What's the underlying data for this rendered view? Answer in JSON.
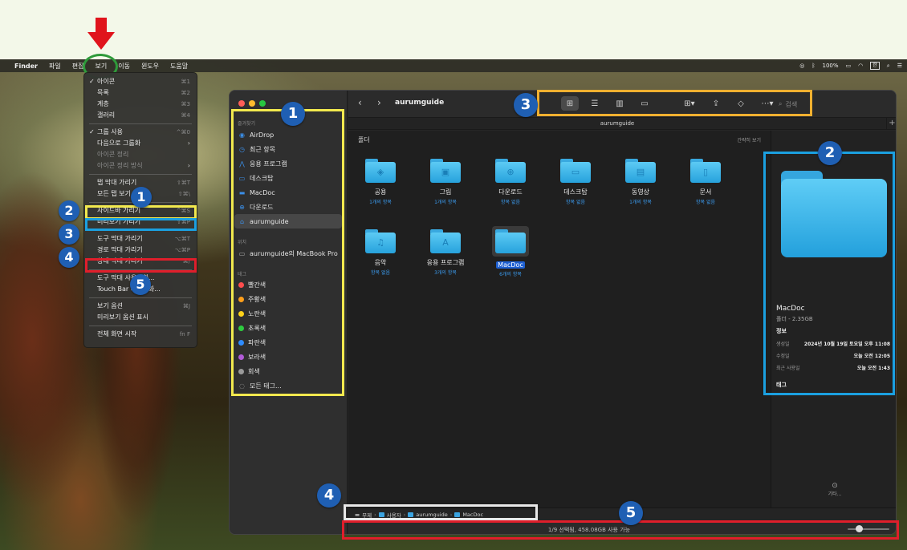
{
  "menubar": {
    "app": "Finder",
    "menus": [
      "파일",
      "편집",
      "보기",
      "이동",
      "윈도우",
      "도움말"
    ],
    "battery": "100%",
    "input_source": "한"
  },
  "view_menu": {
    "items": [
      {
        "label": "아이콘",
        "shortcut": "⌘1",
        "checked": true
      },
      {
        "label": "목록",
        "shortcut": "⌘2"
      },
      {
        "label": "계층",
        "shortcut": "⌘3"
      },
      {
        "label": "갤러리",
        "shortcut": "⌘4"
      },
      {
        "label": "그룹 사용",
        "shortcut": "^⌘0",
        "checked": true
      },
      {
        "label": "다음으로 그룹화",
        "submenu": true
      },
      {
        "label": "아이콘 정리",
        "disabled": true
      },
      {
        "label": "아이콘 정리 방식",
        "disabled": true,
        "submenu": true
      },
      {
        "label": "탭 막대 가리기",
        "shortcut": "⇧⌘T"
      },
      {
        "label": "모든 탭 보기",
        "shortcut": "⇧⌘\\"
      },
      {
        "label": "사이드바 가리기",
        "shortcut": "^⌘S"
      },
      {
        "label": "미리보기 가리기",
        "shortcut": "⇧⌘P"
      },
      {
        "label": "도구 막대 가리기",
        "shortcut": "⌥⌘T"
      },
      {
        "label": "경로 막대 가리기",
        "shortcut": "⌥⌘P"
      },
      {
        "label": "상태 막대 가리기",
        "shortcut": "⌘/"
      },
      {
        "label": "도구 막대 사용자화..."
      },
      {
        "label": "Touch Bar 사용자화..."
      },
      {
        "label": "보기 옵션",
        "shortcut": "⌘J"
      },
      {
        "label": "미리보기 옵션 표시"
      },
      {
        "label": "전체 화면 시작",
        "shortcut": "fn F"
      }
    ]
  },
  "badges": {
    "b1": "1",
    "b2": "2",
    "b3": "3",
    "b4": "4",
    "b5": "5"
  },
  "window": {
    "title": "aurumguide",
    "tab_title": "aurumguide",
    "search_placeholder": "검색",
    "group_title": "폴더",
    "group_action": "간략히 보기"
  },
  "sidebar": {
    "favorites_title": "즐겨찾기",
    "favorites": [
      {
        "label": "AirDrop",
        "icon": "airdrop-icon"
      },
      {
        "label": "최근 항목",
        "icon": "clock-icon"
      },
      {
        "label": "응용 프로그램",
        "icon": "apps-icon"
      },
      {
        "label": "데스크탑",
        "icon": "desktop-icon"
      },
      {
        "label": "MacDoc",
        "icon": "folder-icon"
      },
      {
        "label": "다운로드",
        "icon": "download-icon"
      },
      {
        "label": "aurumguide",
        "icon": "home-icon",
        "active": true
      }
    ],
    "locations_title": "위치",
    "locations": [
      {
        "label": "aurumguide의 MacBook Pro",
        "icon": "laptop-icon"
      }
    ],
    "tags_title": "태그",
    "tags": [
      {
        "label": "빨간색",
        "color": "#ff4d4d"
      },
      {
        "label": "주황색",
        "color": "#ff9f1a"
      },
      {
        "label": "노란색",
        "color": "#ffd21a"
      },
      {
        "label": "초록색",
        "color": "#2ecc40"
      },
      {
        "label": "파란색",
        "color": "#2f8cff"
      },
      {
        "label": "보라색",
        "color": "#b25bd8"
      },
      {
        "label": "회색",
        "color": "#9a9a9a"
      },
      {
        "label": "모든 태그...",
        "color": ""
      }
    ]
  },
  "files": [
    {
      "name": "공용",
      "sub": "1개의 항목",
      "glyph": "◈"
    },
    {
      "name": "그림",
      "sub": "1개의 항목",
      "glyph": "▣"
    },
    {
      "name": "다운로드",
      "sub": "항목 없음",
      "glyph": "⊕"
    },
    {
      "name": "데스크탑",
      "sub": "항목 없음",
      "glyph": "▭"
    },
    {
      "name": "동영상",
      "sub": "1개의 항목",
      "glyph": "▤"
    },
    {
      "name": "문서",
      "sub": "항목 없음",
      "glyph": "▯"
    },
    {
      "name": "음악",
      "sub": "항목 없음",
      "glyph": "♫"
    },
    {
      "name": "응용 프로그램",
      "sub": "3개의 항목",
      "glyph": "A"
    },
    {
      "name": "MacDoc",
      "sub": "6개의 항목",
      "glyph": "",
      "selected": true
    }
  ],
  "preview": {
    "name": "MacDoc",
    "sub": "폴더 - 2.35GB",
    "info_title": "정보",
    "created_k": "생성일",
    "created_v": "2024년 10월 19일 토요일 오후 11:08",
    "modified_k": "수정일",
    "modified_v": "오늘 오전 12:05",
    "opened_k": "최근 사용일",
    "opened_v": "오늘 오전 1:43",
    "tags_title": "태그",
    "more": "기타..."
  },
  "pathbar": [
    "무제",
    "사용자",
    "aurumguide",
    "MacDoc"
  ],
  "statusbar": {
    "text": "1/9 선택됨, 458.08GB 사용 가능"
  }
}
